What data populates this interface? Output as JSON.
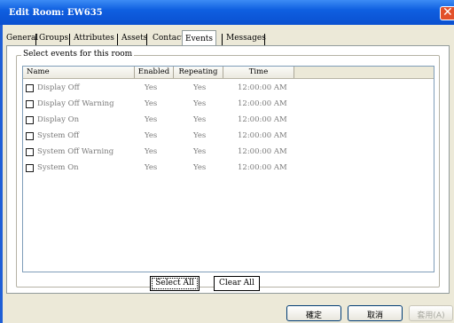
{
  "window": {
    "title": "Edit Room: EW635",
    "close_glyph": "✕"
  },
  "tabs": [
    {
      "label": "General",
      "active": false
    },
    {
      "label": "Groups",
      "active": false
    },
    {
      "label": "Attributes",
      "active": false
    },
    {
      "label": "Assets",
      "active": false
    },
    {
      "label": "Contacts",
      "active": false
    },
    {
      "label": "Events",
      "active": true
    },
    {
      "label": "Messages",
      "active": false
    }
  ],
  "events": {
    "group_label": "Select events for this room",
    "columns": [
      "Name",
      "Enabled",
      "Repeating",
      "Time"
    ],
    "rows": [
      {
        "name": "Display Off",
        "enabled": "Yes",
        "repeating": "Yes",
        "time": "12:00:00 AM",
        "checked": false
      },
      {
        "name": "Display Off Warning",
        "enabled": "Yes",
        "repeating": "Yes",
        "time": "12:00:00 AM",
        "checked": false
      },
      {
        "name": "Display On",
        "enabled": "Yes",
        "repeating": "Yes",
        "time": "12:00:00 AM",
        "checked": false
      },
      {
        "name": "System Off",
        "enabled": "Yes",
        "repeating": "Yes",
        "time": "12:00:00 AM",
        "checked": false
      },
      {
        "name": "System Off Warning",
        "enabled": "Yes",
        "repeating": "Yes",
        "time": "12:00:00 AM",
        "checked": false
      },
      {
        "name": "System On",
        "enabled": "Yes",
        "repeating": "Yes",
        "time": "12:00:00 AM",
        "checked": false
      }
    ],
    "select_all_label": "Select All",
    "clear_all_label": "Clear All"
  },
  "footer": {
    "ok_label": "確定",
    "cancel_label": "取消",
    "apply_label": "套用(A)"
  },
  "colors": {
    "titlebar": "#0a50d0",
    "window_bg": "#ece9d8",
    "disabled_text": "#7a7a7a"
  }
}
